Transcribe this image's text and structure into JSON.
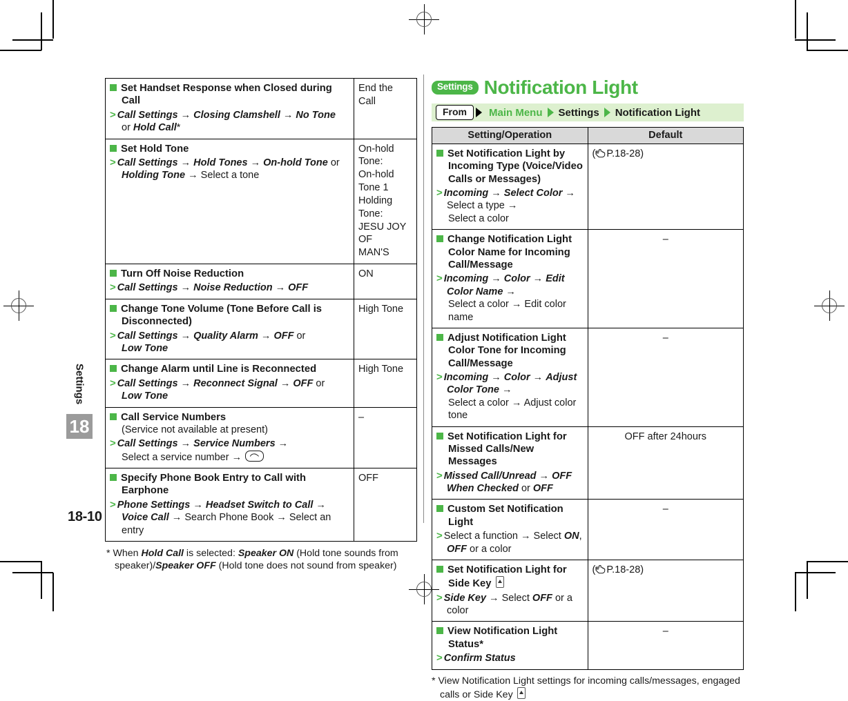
{
  "page": {
    "number": "18-10",
    "chapter_label": "Settings",
    "chapter_number": "18"
  },
  "left_column": {
    "table": {
      "rows": [
        {
          "heading": "Set Handset Response when Closed during Call",
          "sub": "",
          "steps": [
            {
              "prefix": "> ",
              "parts": [
                {
                  "t": "Call Settings",
                  "s": "b"
                },
                {
                  "t": " → ",
                  "s": "a"
                },
                {
                  "t": "Closing Clamshell",
                  "s": "b"
                },
                {
                  "t": " → ",
                  "s": "a"
                },
                {
                  "t": "No Tone",
                  "s": "b"
                }
              ]
            },
            {
              "prefix": "",
              "parts": [
                {
                  "t": "or ",
                  "s": "n"
                },
                {
                  "t": "Hold Call",
                  "s": "b"
                },
                {
                  "t": "*",
                  "s": "n"
                }
              ]
            }
          ],
          "default": "End the Call"
        },
        {
          "heading": "Set Hold Tone",
          "sub": "",
          "steps": [
            {
              "prefix": "> ",
              "parts": [
                {
                  "t": "Call Settings",
                  "s": "b"
                },
                {
                  "t": " → ",
                  "s": "a"
                },
                {
                  "t": "Hold Tones",
                  "s": "b"
                },
                {
                  "t": " → ",
                  "s": "a"
                },
                {
                  "t": "On-hold Tone",
                  "s": "b"
                },
                {
                  "t": " or",
                  "s": "n"
                }
              ]
            },
            {
              "prefix": "",
              "parts": [
                {
                  "t": "Holding Tone",
                  "s": "b"
                },
                {
                  "t": " → ",
                  "s": "a"
                },
                {
                  "t": "Select a tone",
                  "s": "n"
                }
              ]
            }
          ],
          "default": "On-hold Tone:\nOn-hold Tone 1\nHolding Tone:\nJESU JOY OF\nMAN'S"
        },
        {
          "heading": "Turn Off Noise Reduction",
          "sub": "",
          "steps": [
            {
              "prefix": "> ",
              "parts": [
                {
                  "t": "Call Settings",
                  "s": "b"
                },
                {
                  "t": " → ",
                  "s": "a"
                },
                {
                  "t": "Noise Reduction",
                  "s": "b"
                },
                {
                  "t": " → ",
                  "s": "a"
                },
                {
                  "t": "OFF",
                  "s": "b"
                }
              ]
            }
          ],
          "default": "ON"
        },
        {
          "heading": "Change Tone Volume (Tone Before Call is Disconnected)",
          "sub": "",
          "steps": [
            {
              "prefix": "> ",
              "parts": [
                {
                  "t": "Call Settings",
                  "s": "b"
                },
                {
                  "t": " → ",
                  "s": "a"
                },
                {
                  "t": "Quality Alarm",
                  "s": "b"
                },
                {
                  "t": " → ",
                  "s": "a"
                },
                {
                  "t": "OFF",
                  "s": "b"
                },
                {
                  "t": " or",
                  "s": "n"
                }
              ]
            },
            {
              "prefix": "",
              "parts": [
                {
                  "t": "Low Tone",
                  "s": "b"
                }
              ]
            }
          ],
          "default": "High Tone"
        },
        {
          "heading": "Change Alarm until Line is Reconnected",
          "sub": "",
          "steps": [
            {
              "prefix": "> ",
              "parts": [
                {
                  "t": "Call Settings",
                  "s": "b"
                },
                {
                  "t": " → ",
                  "s": "a"
                },
                {
                  "t": "Reconnect Signal",
                  "s": "b"
                },
                {
                  "t": " → ",
                  "s": "a"
                },
                {
                  "t": "OFF",
                  "s": "b"
                },
                {
                  "t": " or",
                  "s": "n"
                }
              ]
            },
            {
              "prefix": "",
              "parts": [
                {
                  "t": "Low Tone",
                  "s": "b"
                }
              ]
            }
          ],
          "default": "–"
        },
        {
          "heading": "Call Service Numbers",
          "sub": "(Service not available at present)",
          "steps": [
            {
              "prefix": "> ",
              "parts": [
                {
                  "t": "Call Settings",
                  "s": "b"
                },
                {
                  "t": " → ",
                  "s": "a"
                },
                {
                  "t": "Service Numbers",
                  "s": "b"
                },
                {
                  "t": " →",
                  "s": "a"
                }
              ]
            },
            {
              "prefix": "",
              "parts": [
                {
                  "t": "Select a service number → ",
                  "s": "n"
                },
                {
                  "t": "call-key-icon",
                  "s": "icon-call"
                }
              ]
            }
          ],
          "default": "–"
        },
        {
          "heading": "Specify Phone Book Entry to Call with Earphone",
          "sub": "",
          "steps": [
            {
              "prefix": "> ",
              "parts": [
                {
                  "t": "Phone Settings",
                  "s": "b"
                },
                {
                  "t": " → ",
                  "s": "a"
                },
                {
                  "t": "Headset Switch to Call",
                  "s": "b"
                },
                {
                  "t": " →",
                  "s": "a"
                }
              ]
            },
            {
              "prefix": "",
              "parts": [
                {
                  "t": "Voice Call",
                  "s": "b"
                },
                {
                  "t": " → ",
                  "s": "a"
                },
                {
                  "t": "Search Phone Book → Select an entry",
                  "s": "n"
                }
              ]
            }
          ],
          "default": "OFF"
        }
      ],
      "row_defaults_override": [
        "End the Call",
        "",
        "ON",
        "High Tone",
        "High Tone",
        "–",
        "OFF"
      ]
    },
    "footnote": {
      "marker": "*",
      "parts": [
        {
          "t": "When ",
          "s": "n"
        },
        {
          "t": "Hold Call",
          "s": "b"
        },
        {
          "t": " is selected: ",
          "s": "n"
        },
        {
          "t": "Speaker ON",
          "s": "b"
        },
        {
          "t": " (Hold tone sounds from speaker)/",
          "s": "n"
        },
        {
          "t": "Speaker OFF",
          "s": "b"
        },
        {
          "t": " (Hold tone does not sound from speaker)",
          "s": "n"
        }
      ]
    }
  },
  "right_column": {
    "section": {
      "badge": "Settings",
      "title": "Notification Light"
    },
    "breadcrumb": {
      "from_label": "From",
      "items": [
        "Main Menu",
        "Settings",
        "Notification Light"
      ]
    },
    "table": {
      "headers": [
        "Setting/Operation",
        "Default"
      ],
      "rows": [
        {
          "heading": "Set Notification Light by Incoming Type (Voice/Video Calls or Messages)",
          "sub": "",
          "steps": [
            {
              "prefix": "> ",
              "parts": [
                {
                  "t": "Incoming",
                  "s": "b"
                },
                {
                  "t": " → ",
                  "s": "a"
                },
                {
                  "t": "Select Color",
                  "s": "b"
                },
                {
                  "t": " → ",
                  "s": "a"
                },
                {
                  "t": "Select a type →",
                  "s": "n"
                }
              ]
            },
            {
              "prefix": "",
              "parts": [
                {
                  "t": "Select a color",
                  "s": "n"
                }
              ]
            }
          ],
          "default": "(☞P.18-28)",
          "default_kind": "ref",
          "default_ref": "P.18-28"
        },
        {
          "heading": "Change Notification Light Color Name for Incoming Call/Message",
          "sub": "",
          "steps": [
            {
              "prefix": "> ",
              "parts": [
                {
                  "t": "Incoming",
                  "s": "b"
                },
                {
                  "t": " → ",
                  "s": "a"
                },
                {
                  "t": "Color",
                  "s": "b"
                },
                {
                  "t": " → ",
                  "s": "a"
                },
                {
                  "t": "Edit Color Name",
                  "s": "b"
                },
                {
                  "t": " →",
                  "s": "a"
                }
              ]
            },
            {
              "prefix": "",
              "parts": [
                {
                  "t": "Select a color → Edit color name",
                  "s": "n"
                }
              ]
            }
          ],
          "default": "–",
          "default_kind": "text"
        },
        {
          "heading": "Adjust Notification Light Color Tone for Incoming Call/Message",
          "sub": "",
          "steps": [
            {
              "prefix": "> ",
              "parts": [
                {
                  "t": "Incoming",
                  "s": "b"
                },
                {
                  "t": " → ",
                  "s": "a"
                },
                {
                  "t": "Color",
                  "s": "b"
                },
                {
                  "t": " → ",
                  "s": "a"
                },
                {
                  "t": "Adjust Color Tone",
                  "s": "b"
                },
                {
                  "t": " →",
                  "s": "a"
                }
              ]
            },
            {
              "prefix": "",
              "parts": [
                {
                  "t": "Select a color → Adjust color tone",
                  "s": "n"
                }
              ]
            }
          ],
          "default": "–",
          "default_kind": "text"
        },
        {
          "heading": "Set Notification Light for Missed Calls/New Messages",
          "sub": "",
          "steps": [
            {
              "prefix": "> ",
              "parts": [
                {
                  "t": "Missed Call/Unread",
                  "s": "b"
                },
                {
                  "t": " → ",
                  "s": "a"
                },
                {
                  "t": "OFF When Checked",
                  "s": "b"
                },
                {
                  "t": " or ",
                  "s": "n"
                },
                {
                  "t": "OFF",
                  "s": "b"
                }
              ]
            }
          ],
          "default": "OFF after 24hours",
          "default_kind": "text"
        },
        {
          "heading": "Custom Set Notification Light",
          "sub": "",
          "steps": [
            {
              "prefix": "> ",
              "parts": [
                {
                  "t": "Select a function → Select ",
                  "s": "n"
                },
                {
                  "t": "ON",
                  "s": "b"
                },
                {
                  "t": ", ",
                  "s": "n"
                },
                {
                  "t": "OFF",
                  "s": "b"
                },
                {
                  "t": " or a color",
                  "s": "n"
                }
              ]
            }
          ],
          "default": "–",
          "default_kind": "text"
        },
        {
          "heading": "Set Notification Light for Side Key",
          "heading_icon": "side-key-icon",
          "sub": "",
          "steps": [
            {
              "prefix": "> ",
              "parts": [
                {
                  "t": "Side Key",
                  "s": "b"
                },
                {
                  "t": " → ",
                  "s": "a"
                },
                {
                  "t": "Select ",
                  "s": "n"
                },
                {
                  "t": "OFF",
                  "s": "b"
                },
                {
                  "t": " or a color",
                  "s": "n"
                }
              ]
            }
          ],
          "default": "(☞P.18-28)",
          "default_kind": "ref",
          "default_ref": "P.18-28"
        },
        {
          "heading": "View Notification Light Status*",
          "sub": "",
          "steps": [
            {
              "prefix": "> ",
              "parts": [
                {
                  "t": "Confirm Status",
                  "s": "b"
                }
              ]
            }
          ],
          "default": "–",
          "default_kind": "text"
        }
      ]
    },
    "footnote": {
      "marker": "*",
      "text_before_icon": "View Notification Light settings for incoming calls/messages, engaged calls or Side Key",
      "icon": "side-key-icon"
    }
  },
  "colors": {
    "accent_green": "#4CB648",
    "breadcrumb_bg": "#DDF0CF",
    "table_header_bg": "#D9D9D9",
    "chapter_tab_bg": "#9B9B9B"
  }
}
